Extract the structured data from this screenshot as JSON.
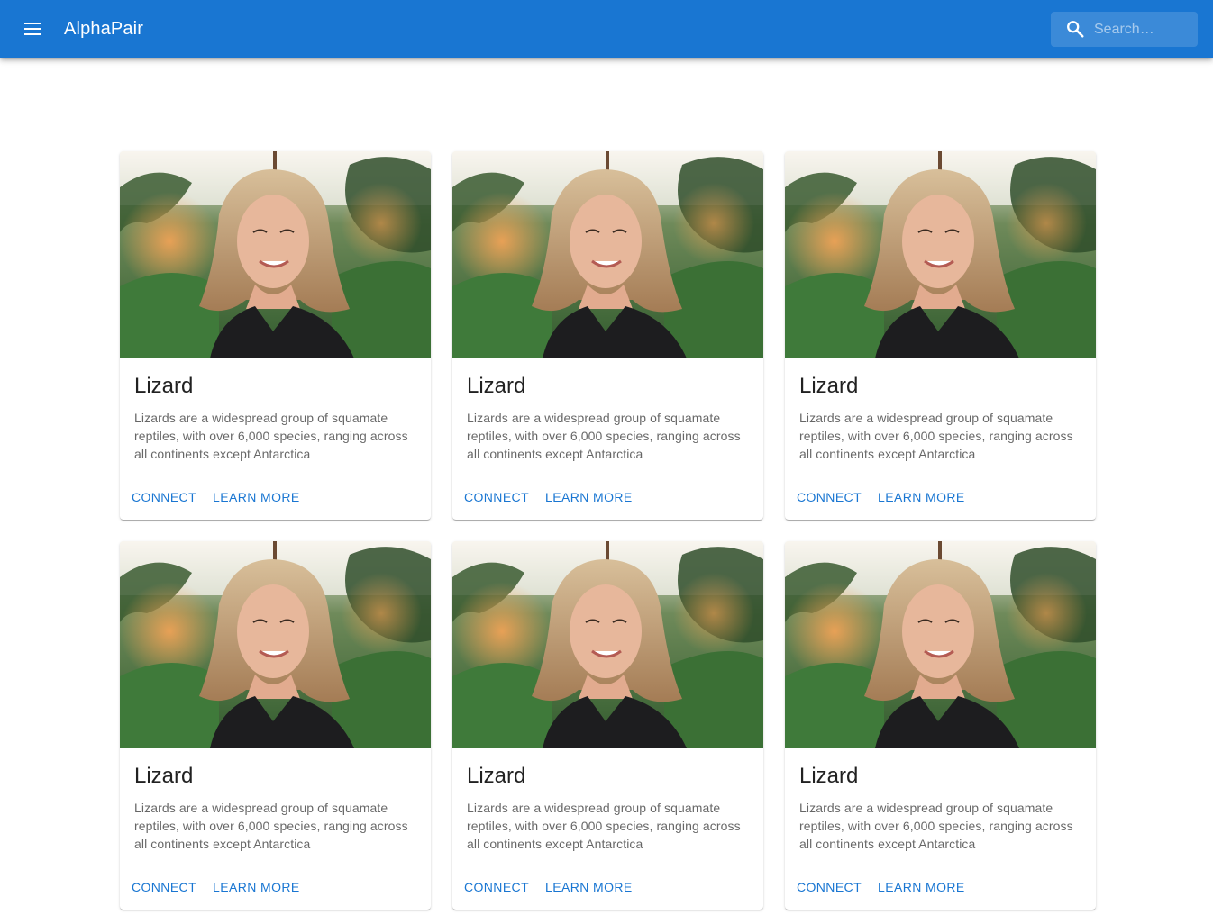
{
  "appbar": {
    "title": "AlphaPair",
    "menu_icon": "menu-icon",
    "search_icon": "search-icon",
    "search_placeholder": "Search…",
    "color": "#1976d2"
  },
  "cards": [
    {
      "image": "portrait-photo",
      "title": "Lizard",
      "description": "Lizards are a widespread group of squamate reptiles, with over 6,000 species, ranging across all continents except Antarctica",
      "connect_label": "CONNECT",
      "learn_more_label": "LEARN MORE"
    },
    {
      "image": "portrait-photo",
      "title": "Lizard",
      "description": "Lizards are a widespread group of squamate reptiles, with over 6,000 species, ranging across all continents except Antarctica",
      "connect_label": "CONNECT",
      "learn_more_label": "LEARN MORE"
    },
    {
      "image": "portrait-photo",
      "title": "Lizard",
      "description": "Lizards are a widespread group of squamate reptiles, with over 6,000 species, ranging across all continents except Antarctica",
      "connect_label": "CONNECT",
      "learn_more_label": "LEARN MORE"
    },
    {
      "image": "portrait-photo",
      "title": "Lizard",
      "description": "Lizards are a widespread group of squamate reptiles, with over 6,000 species, ranging across all continents except Antarctica",
      "connect_label": "CONNECT",
      "learn_more_label": "LEARN MORE"
    },
    {
      "image": "portrait-photo",
      "title": "Lizard",
      "description": "Lizards are a widespread group of squamate reptiles, with over 6,000 species, ranging across all continents except Antarctica",
      "connect_label": "CONNECT",
      "learn_more_label": "LEARN MORE"
    },
    {
      "image": "portrait-photo",
      "title": "Lizard",
      "description": "Lizards are a widespread group of squamate reptiles, with over 6,000 species, ranging across all continents except Antarctica",
      "connect_label": "CONNECT",
      "learn_more_label": "LEARN MORE"
    }
  ]
}
